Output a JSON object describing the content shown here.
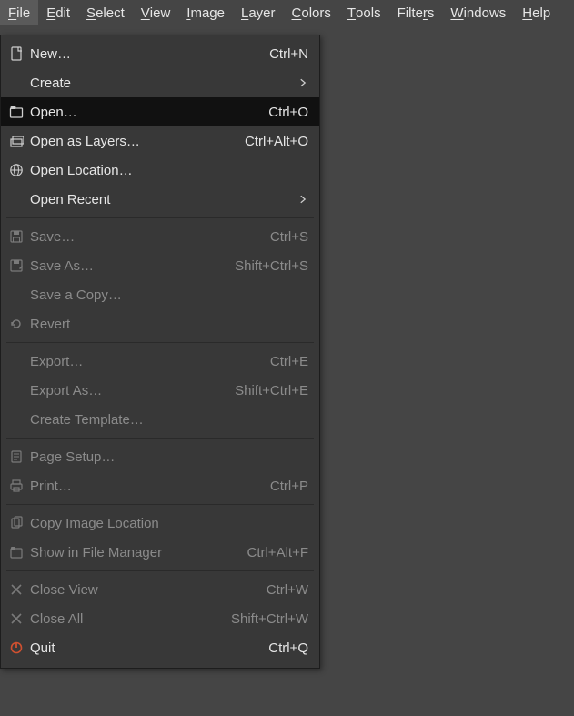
{
  "menubar": {
    "items": [
      {
        "label": "File",
        "mnemonic": "F",
        "active": true
      },
      {
        "label": "Edit",
        "mnemonic": "E"
      },
      {
        "label": "Select",
        "mnemonic": "S"
      },
      {
        "label": "View",
        "mnemonic": "V"
      },
      {
        "label": "Image",
        "mnemonic": "I"
      },
      {
        "label": "Layer",
        "mnemonic": "L"
      },
      {
        "label": "Colors",
        "mnemonic": "C"
      },
      {
        "label": "Tools",
        "mnemonic": "T"
      },
      {
        "label": "Filters",
        "mnemonic": "R",
        "index": 5
      },
      {
        "label": "Windows",
        "mnemonic": "W"
      },
      {
        "label": "Help",
        "mnemonic": "H"
      }
    ]
  },
  "file_menu": {
    "groups": [
      [
        {
          "id": "new",
          "label": "New…",
          "accel": "Ctrl+N",
          "icon": "file-icon"
        },
        {
          "id": "create",
          "label": "Create",
          "submenu": true
        },
        {
          "id": "open",
          "label": "Open…",
          "accel": "Ctrl+O",
          "icon": "open-folder-icon",
          "highlight": true
        },
        {
          "id": "open-as-layers",
          "label": "Open as Layers…",
          "accel": "Ctrl+Alt+O",
          "icon": "layers-icon"
        },
        {
          "id": "open-location",
          "label": "Open Location…",
          "icon": "globe-icon"
        },
        {
          "id": "open-recent",
          "label": "Open Recent",
          "submenu": true
        }
      ],
      [
        {
          "id": "save",
          "label": "Save…",
          "accel": "Ctrl+S",
          "icon": "save-icon",
          "disabled": true
        },
        {
          "id": "save-as",
          "label": "Save As…",
          "accel": "Shift+Ctrl+S",
          "icon": "save-as-icon",
          "disabled": true
        },
        {
          "id": "save-a-copy",
          "label": "Save a Copy…",
          "disabled": true
        },
        {
          "id": "revert",
          "label": "Revert",
          "icon": "revert-icon",
          "disabled": true
        }
      ],
      [
        {
          "id": "export",
          "label": "Export…",
          "accel": "Ctrl+E",
          "disabled": true
        },
        {
          "id": "export-as",
          "label": "Export As…",
          "accel": "Shift+Ctrl+E",
          "disabled": true
        },
        {
          "id": "create-template",
          "label": "Create Template…",
          "disabled": true
        }
      ],
      [
        {
          "id": "page-setup",
          "label": "Page Setup…",
          "icon": "page-setup-icon",
          "disabled": true
        },
        {
          "id": "print",
          "label": "Print…",
          "accel": "Ctrl+P",
          "icon": "print-icon",
          "disabled": true
        }
      ],
      [
        {
          "id": "copy-image-location",
          "label": "Copy Image Location",
          "icon": "copy-icon",
          "disabled": true
        },
        {
          "id": "show-in-file-manager",
          "label": "Show in File Manager",
          "accel": "Ctrl+Alt+F",
          "icon": "file-manager-icon",
          "disabled": true
        }
      ],
      [
        {
          "id": "close-view",
          "label": "Close View",
          "accel": "Ctrl+W",
          "icon": "close-icon",
          "disabled": true
        },
        {
          "id": "close-all",
          "label": "Close All",
          "accel": "Shift+Ctrl+W",
          "icon": "close-icon",
          "disabled": true
        },
        {
          "id": "quit",
          "label": "Quit",
          "accel": "Ctrl+Q",
          "icon": "quit-icon"
        }
      ]
    ]
  }
}
